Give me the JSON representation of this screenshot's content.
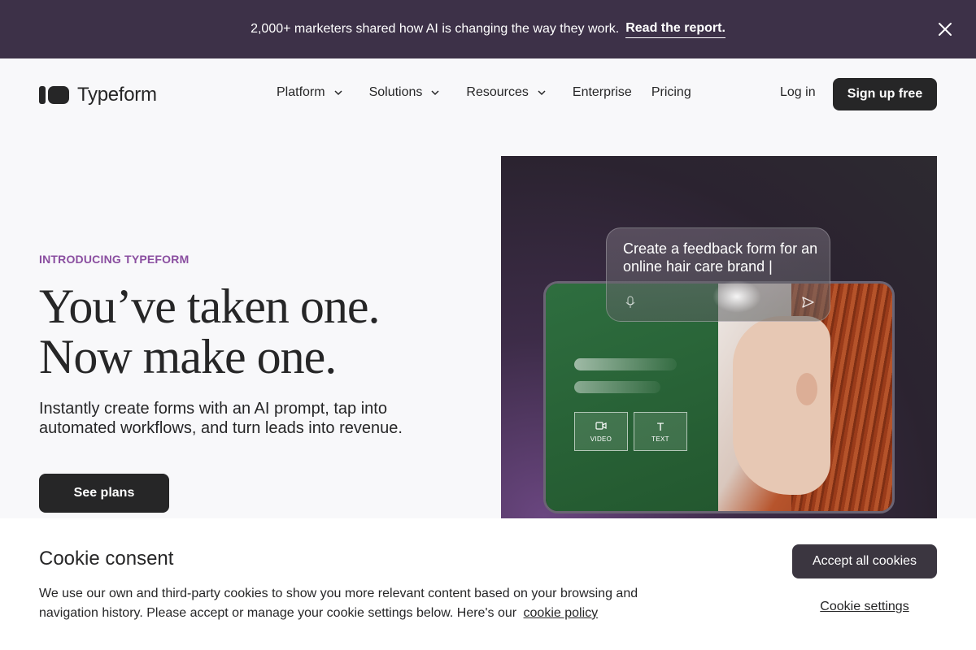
{
  "banner": {
    "text": "2,000+ marketers shared how AI is changing the way they work.",
    "link": "Read the report.",
    "close_icon": "close-icon"
  },
  "nav": {
    "logo_text": "Typeform",
    "items": [
      {
        "label": "Platform",
        "has_dropdown": true
      },
      {
        "label": "Solutions",
        "has_dropdown": true
      },
      {
        "label": "Resources",
        "has_dropdown": true
      },
      {
        "label": "Enterprise",
        "has_dropdown": false
      },
      {
        "label": "Pricing",
        "has_dropdown": false
      }
    ],
    "login": "Log in",
    "signup": "Sign up free"
  },
  "hero": {
    "eyebrow": "INTRODUCING TYPEFORM",
    "headline_line1": "You’ve taken one.",
    "headline_line2": "Now make one.",
    "subtext": "Instantly create forms with an AI prompt, tap into automated workflows, and turn leads into revenue.",
    "cta": "See plans",
    "image": {
      "prompt_text": "Create a feedback form for an online hair care brand |",
      "chip_video": "VIDEO",
      "chip_text": "TEXT",
      "chip_text_glyph": "T"
    }
  },
  "cookie": {
    "title": "Cookie consent",
    "body": "We use our own and third-party cookies to show you more relevant content based on your browsing and navigation history. Please accept or manage your cookie settings below. Here's our",
    "link": "cookie policy",
    "accept": "Accept all cookies",
    "settings": "Cookie settings"
  },
  "colors": {
    "banner_bg": "#3d3148",
    "accent_purple": "#8a4ea0",
    "button_dark": "#262627",
    "page_bg": "#f8f8fa"
  }
}
